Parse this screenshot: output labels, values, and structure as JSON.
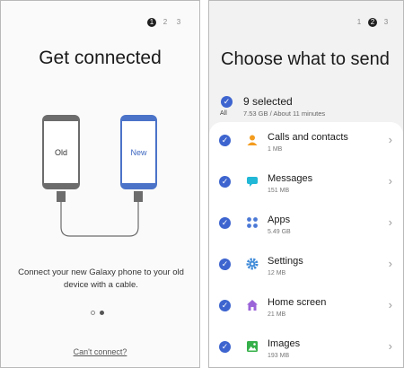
{
  "left": {
    "steps": [
      "1",
      "2",
      "3"
    ],
    "title": "Get connected",
    "old_label": "Old",
    "new_label": "New",
    "description": "Connect your new Galaxy phone to your old device with a cable.",
    "link": "Can't connect?"
  },
  "right": {
    "steps": [
      "1",
      "2",
      "3"
    ],
    "title": "Choose what to send",
    "all_label": "All",
    "selected_count": "9 selected",
    "selected_size": "7.53 GB / About 11 minutes",
    "items": [
      {
        "name": "Calls and contacts",
        "size": "1 MB",
        "icon": "contacts-icon",
        "color": "#f39c1f"
      },
      {
        "name": "Messages",
        "size": "151 MB",
        "icon": "messages-icon",
        "color": "#21b7d6"
      },
      {
        "name": "Apps",
        "size": "5.49 GB",
        "icon": "apps-icon",
        "color": "#4a78d6"
      },
      {
        "name": "Settings",
        "size": "12 MB",
        "icon": "settings-icon",
        "color": "#3f8ad8"
      },
      {
        "name": "Home screen",
        "size": "21 MB",
        "icon": "home-screen-icon",
        "color": "#9a63d8"
      },
      {
        "name": "Images",
        "size": "193 MB",
        "icon": "images-icon",
        "color": "#36b04a"
      }
    ]
  },
  "colors": {
    "accent": "#3e65cf",
    "new_phone": "#4b73c8",
    "old_phone": "#6c6c6c"
  }
}
